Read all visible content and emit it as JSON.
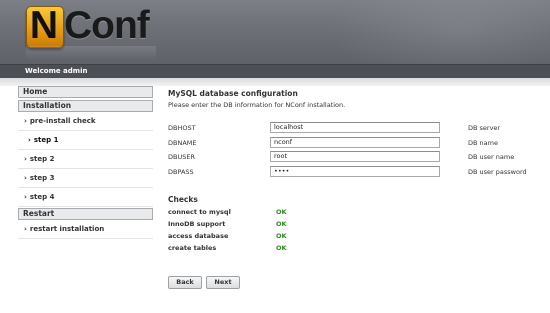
{
  "app": {
    "logo_text_n": "N",
    "logo_text_rest": "Conf"
  },
  "header": {
    "welcome": "Welcome admin"
  },
  "sidebar": {
    "home": "Home",
    "installation": "Installation",
    "items": [
      {
        "label": "pre-install check",
        "arrow": "›"
      },
      {
        "label": "step 1",
        "arrow": "›",
        "active": true
      },
      {
        "label": "step 2",
        "arrow": "›"
      },
      {
        "label": "step 3",
        "arrow": "›"
      },
      {
        "label": "step 4",
        "arrow": "›"
      }
    ],
    "restart": "Restart",
    "restart_items": [
      {
        "label": "restart installation",
        "arrow": "›"
      }
    ]
  },
  "main": {
    "title": "MySQL database configuration",
    "intro": "Please enter the DB information for NConf installation.",
    "fields": [
      {
        "label": "DBHOST",
        "value": "localhost",
        "hint": "DB server"
      },
      {
        "label": "DBNAME",
        "value": "nconf",
        "hint": "DB name"
      },
      {
        "label": "DBUSER",
        "value": "root",
        "hint": "DB user name"
      },
      {
        "label": "DBPASS",
        "value": "••••",
        "hint": "DB user password"
      }
    ],
    "checks_title": "Checks",
    "checks": [
      {
        "label": "connect to mysql",
        "status": "OK"
      },
      {
        "label": "InnoDB support",
        "status": "OK"
      },
      {
        "label": "access database",
        "status": "OK"
      },
      {
        "label": "create tables",
        "status": "OK"
      }
    ],
    "back_label": "Back",
    "next_label": "Next"
  },
  "colors": {
    "header_bg": "#6a6d74",
    "welcome_bar_bg": "#4c4f55",
    "logo_accent": "#f0b020",
    "ok_green": "#2e8b1e"
  }
}
